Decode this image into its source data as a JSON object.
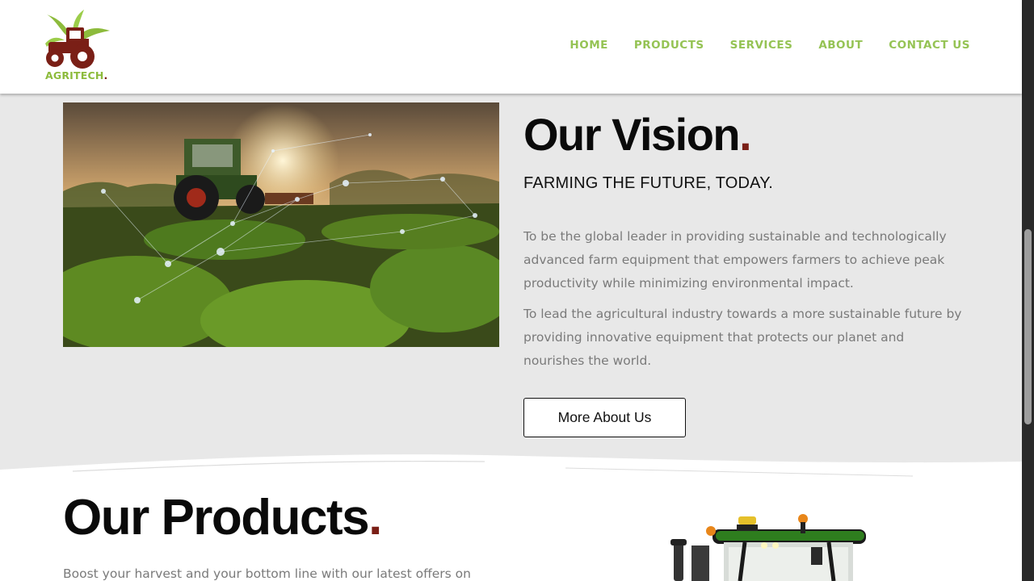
{
  "header": {
    "logo_text": "AGRITECH",
    "logo_dot": ".",
    "nav": [
      "HOME",
      "PRODUCTS",
      "SERVICES",
      "ABOUT",
      "CONTACT US"
    ]
  },
  "vision": {
    "title": "Our Vision",
    "title_dot": ".",
    "subtitle": "FARMING THE FUTURE, TODAY.",
    "paragraph_1": "To be the global leader in providing sustainable and technologically advanced farm equipment that empowers farmers to achieve peak productivity while minimizing environmental impact.",
    "paragraph_2": "To lead the agricultural industry towards a more sustainable future by providing innovative equipment that protects our planet and nourishes the world.",
    "button_label": "More About Us"
  },
  "products": {
    "title": "Our Products",
    "title_dot": ".",
    "intro": "Boost your harvest and your bottom line with our latest offers on"
  },
  "colors": {
    "brand_green": "#95c354",
    "brand_red": "#7a1f16",
    "vision_bg": "#e8e8e8"
  }
}
